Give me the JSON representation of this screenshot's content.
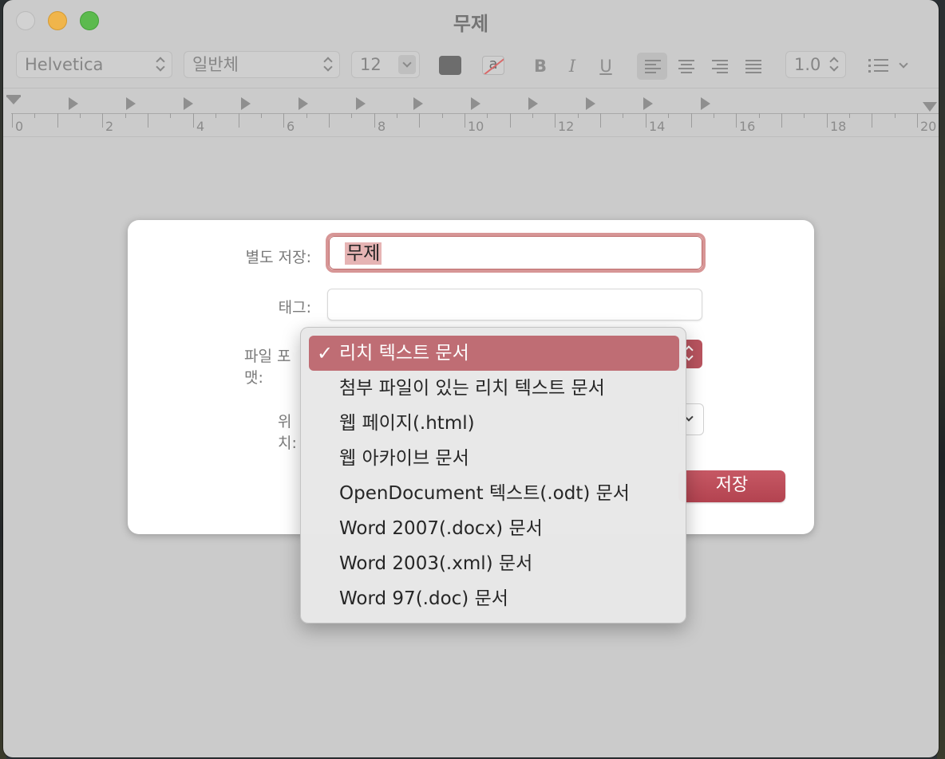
{
  "window": {
    "title": "무제"
  },
  "toolbar": {
    "font_family": "Helvetica",
    "font_style": "일반체",
    "font_size": "12",
    "text_color": "#6d6d6d",
    "highlight_glyph": "a",
    "bold": "B",
    "italic": "I",
    "underline": "U",
    "alignment": [
      "align-left",
      "align-center",
      "align-right",
      "align-justify"
    ],
    "active_alignment": "align-left",
    "line_spacing": "1.0",
    "list_icon": "bulleted-list-icon"
  },
  "ruler": {
    "labels": [
      "0",
      "2",
      "4",
      "6",
      "8",
      "10",
      "12",
      "14",
      "16",
      "18",
      "20"
    ]
  },
  "save_sheet": {
    "save_as_label": "별도 저장:",
    "save_as_value": "무제",
    "tags_label": "태그:",
    "tags_value": "",
    "format_label": "파일 포맷:",
    "location_label": "위치:",
    "save_button": "저장"
  },
  "format_menu": {
    "items": [
      {
        "label": "리치 텍스트 문서",
        "selected": true
      },
      {
        "label": "첨부 파일이 있는 리치 텍스트 문서",
        "selected": false
      },
      {
        "label": "웹 페이지(.html)",
        "selected": false
      },
      {
        "label": "웹 아카이브 문서",
        "selected": false
      },
      {
        "label": "OpenDocument 텍스트(.odt) 문서",
        "selected": false
      },
      {
        "label": "Word 2007(.docx) 문서",
        "selected": false
      },
      {
        "label": "Word 2003(.xml) 문서",
        "selected": false
      },
      {
        "label": "Word 97(.doc) 문서",
        "selected": false
      }
    ],
    "check_glyph": "✓"
  },
  "colors": {
    "accent": "#bf6d74",
    "save_button": "#b94b57",
    "window_bg": "#cbcbcb"
  }
}
